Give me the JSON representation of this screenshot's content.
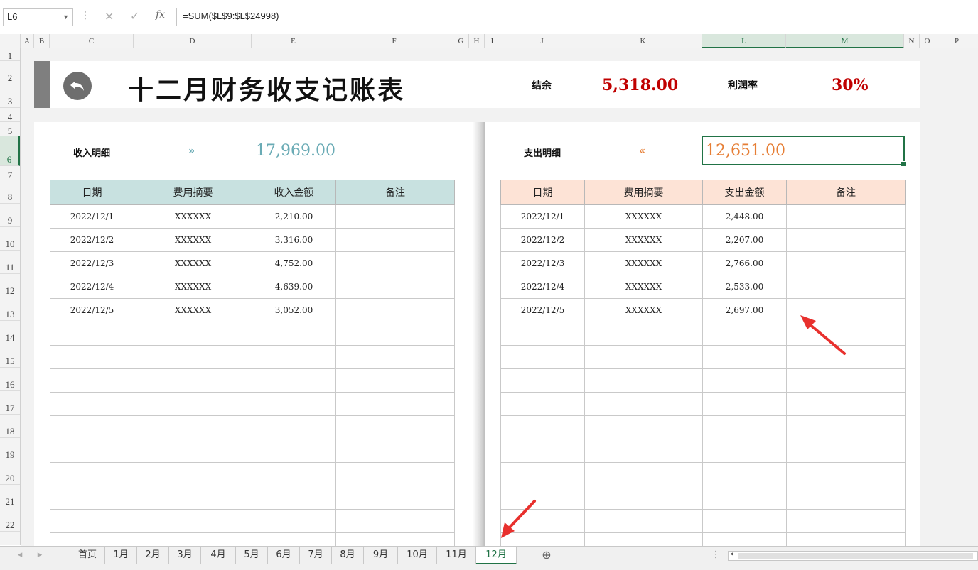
{
  "formula_bar": {
    "name_box": "L6",
    "cancel_icon": "×",
    "enter_icon": "✓",
    "fx_label": "fx",
    "formula": "=SUM($L$9:$L$24998)"
  },
  "columns": [
    "A",
    "B",
    "C",
    "D",
    "E",
    "F",
    "G",
    "H",
    "I",
    "J",
    "K",
    "L",
    "M",
    "N",
    "O",
    "P"
  ],
  "rows": [
    "1",
    "2",
    "3",
    "4",
    "5",
    "6",
    "7",
    "8",
    "9",
    "10",
    "11",
    "12",
    "13",
    "14",
    "15",
    "16",
    "17",
    "18",
    "19",
    "20",
    "21",
    "22"
  ],
  "header": {
    "title": "十二月财务收支记账表",
    "balance_label": "结余",
    "balance_value": "5,318.00",
    "profit_label": "利润率",
    "profit_value": "30%"
  },
  "income": {
    "label": "收入明细",
    "arrow": "»",
    "total": "17,969.00",
    "columns": [
      "日期",
      "费用摘要",
      "收入金额",
      "备注"
    ],
    "rows": [
      [
        "2022/12/1",
        "XXXXXX",
        "2,210.00",
        ""
      ],
      [
        "2022/12/2",
        "XXXXXX",
        "3,316.00",
        ""
      ],
      [
        "2022/12/3",
        "XXXXXX",
        "4,752.00",
        ""
      ],
      [
        "2022/12/4",
        "XXXXXX",
        "4,639.00",
        ""
      ],
      [
        "2022/12/5",
        "XXXXXX",
        "3,052.00",
        ""
      ]
    ]
  },
  "expense": {
    "label": "支出明细",
    "arrow": "«",
    "total": "12,651.00",
    "columns": [
      "日期",
      "费用摘要",
      "支出金额",
      "备注"
    ],
    "rows": [
      [
        "2022/12/1",
        "XXXXXX",
        "2,448.00",
        ""
      ],
      [
        "2022/12/2",
        "XXXXXX",
        "2,207.00",
        ""
      ],
      [
        "2022/12/3",
        "XXXXXX",
        "2,766.00",
        ""
      ],
      [
        "2022/12/4",
        "XXXXXX",
        "2,533.00",
        ""
      ],
      [
        "2022/12/5",
        "XXXXXX",
        "2,697.00",
        ""
      ]
    ]
  },
  "sheet_tabs": [
    "首页",
    "1月",
    "2月",
    "3月",
    "4月",
    "5月",
    "6月",
    "7月",
    "8月",
    "9月",
    "10月",
    "11月",
    "12月"
  ],
  "active_tab": "12月",
  "colors": {
    "accent_green": "#217346",
    "income_header": "#c8e1e0",
    "expense_header": "#fde3d6",
    "income_total": "#6aabb5",
    "expense_total": "#e67e35",
    "highlight_red": "#c00000"
  }
}
